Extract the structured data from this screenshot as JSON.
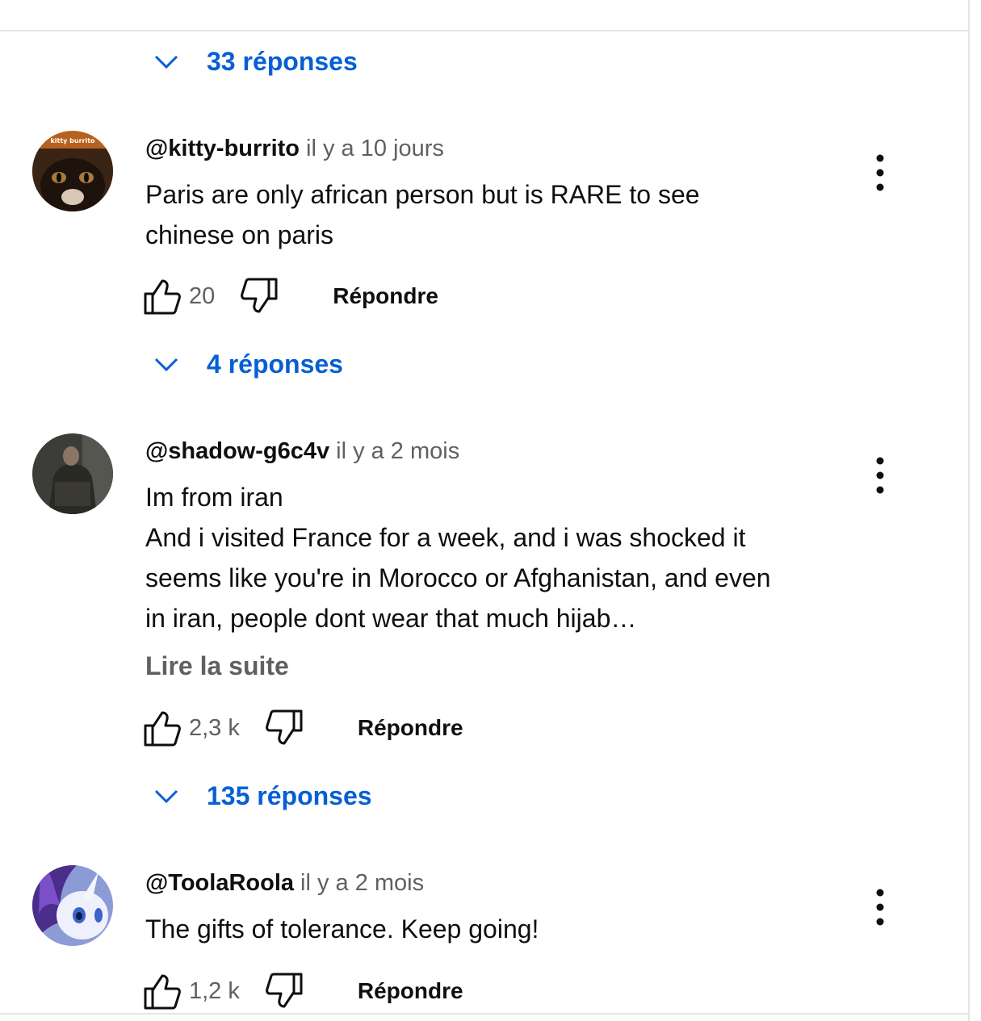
{
  "top_replies": {
    "label": "33 réponses"
  },
  "comments": [
    {
      "author": "@kitty-burrito",
      "time": "il y a 10 jours",
      "avatar_text": "kitty burrito",
      "lines": [
        "Paris are only african person but is RARE to see",
        "chinese on paris"
      ],
      "likes": "20",
      "reply_label": "Répondre",
      "replies_label": "4 réponses"
    },
    {
      "author": "@shadow-g6c4v",
      "time": "il y a 2 mois",
      "lines": [
        "Im from iran",
        "And i visited France for a week, and i was shocked it",
        "seems like you're in Morocco or Afghanistan, and even",
        "in iran, people dont wear that much hijab…"
      ],
      "read_more": "Lire la suite",
      "likes": "2,3 k",
      "reply_label": "Répondre",
      "replies_label": "135 réponses"
    },
    {
      "author": "@ToolaRoola",
      "time": "il y a 2 mois",
      "lines": [
        "The gifts of tolerance. Keep going!"
      ],
      "likes": "1,2 k",
      "reply_label": "Répondre"
    }
  ],
  "colors": {
    "link": "#065fd4",
    "text": "#0f0f0f",
    "secondary": "#606060"
  },
  "icons": [
    "chevron-down-icon",
    "thumbs-up-icon",
    "thumbs-down-icon",
    "more-vert-icon"
  ]
}
